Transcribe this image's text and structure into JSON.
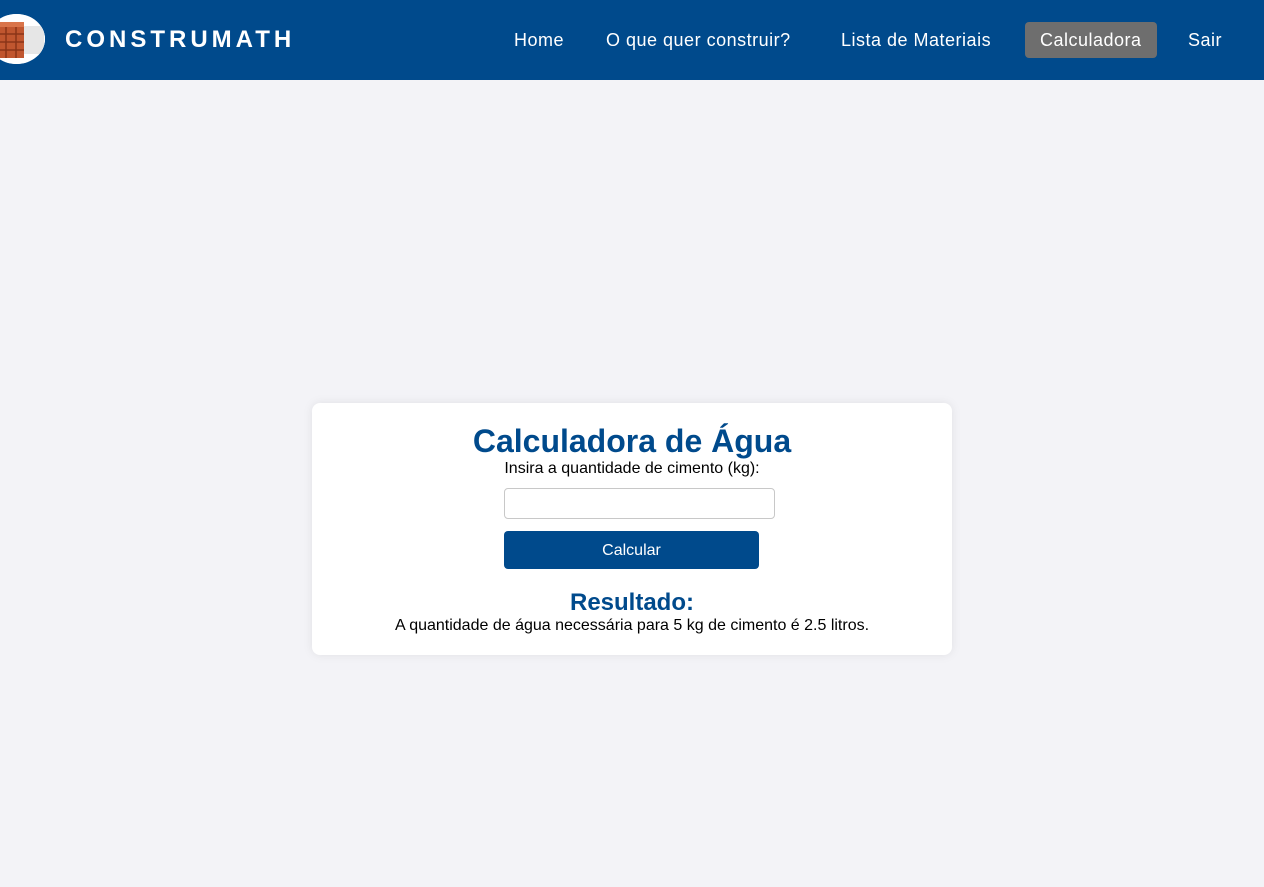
{
  "header": {
    "brand": "CONSTRUMATH",
    "logo_icon": "brick-icon",
    "nav": [
      {
        "label": "Home",
        "active": false
      },
      {
        "label": "O que quer construir?",
        "active": false
      },
      {
        "label": "Lista de Materiais",
        "active": false
      },
      {
        "label": "Calculadora",
        "active": true
      },
      {
        "label": "Sair",
        "active": false
      }
    ]
  },
  "calculator": {
    "title": "Calculadora de Água",
    "input_label": "Insira a quantidade de cimento (kg):",
    "input_value": "",
    "input_placeholder": "",
    "button_label": "Calcular",
    "result_title": "Resultado:",
    "result_text": "A quantidade de água necessária para 5 kg de cimento é 2.5 litros."
  },
  "colors": {
    "primary": "#004a8c",
    "background": "#f3f3f7",
    "active_nav": "#6e6e6e",
    "card": "#ffffff"
  }
}
